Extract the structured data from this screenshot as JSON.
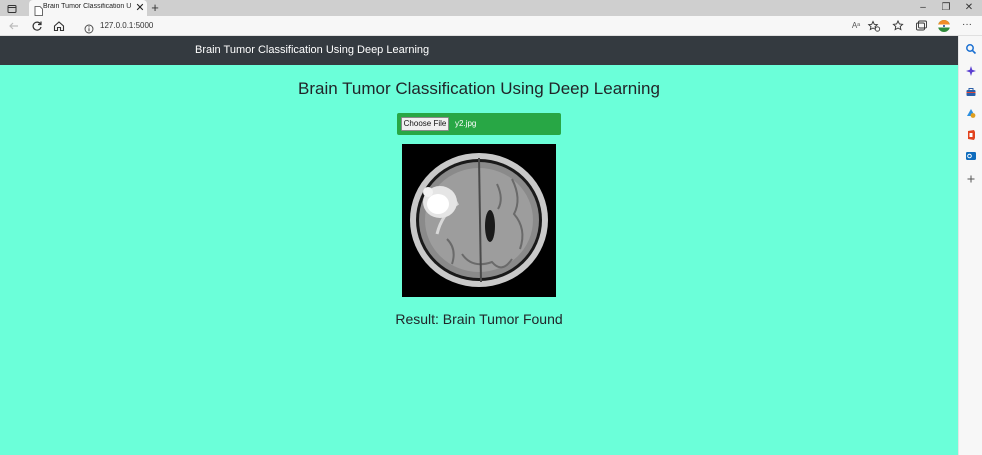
{
  "browser": {
    "tab_title": "Brain Tumor Classification Using Deep Learning",
    "tab_close": "✕",
    "new_tab": "+",
    "url": "127.0.0.1:5000",
    "window_buttons": {
      "minimize": "–",
      "restore": "❐",
      "close": "✕"
    },
    "more_menu": "···",
    "read_aloud": "Aᵃ"
  },
  "page": {
    "navbar_brand": "Brain Tumor Classification Using Deep Learning",
    "heading": "Brain Tumor Classification Using Deep Learning",
    "upload": {
      "button_label": "Choose File",
      "file_name": "y2.jpg"
    },
    "result_text": "Result: Brain Tumor Found"
  },
  "colors": {
    "page_background": "#6bffd9",
    "navbar": "#343a40",
    "upload_box": "#28a745"
  },
  "sidebar_icons": [
    "search-icon",
    "copilot-sparkle-icon",
    "toolbox-icon",
    "games-icon",
    "office-icon",
    "outlook-icon",
    "add-icon"
  ]
}
